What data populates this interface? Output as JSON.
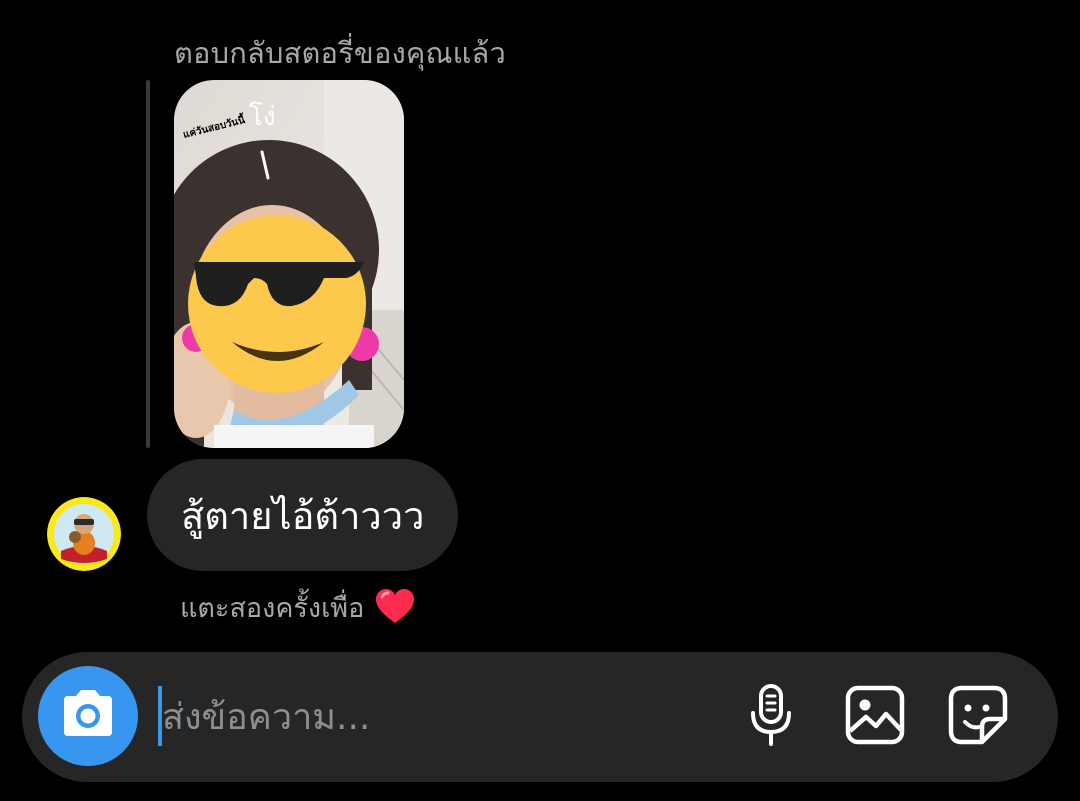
{
  "thread": {
    "reply_context": "ตอบกลับสตอรี่ของคุณแล้ว",
    "story_stickers": {
      "caption": "แค่วันสอบวันนี้",
      "handwriting": "โง่"
    },
    "message": {
      "text": "สู้ตายไอ้ต้าววว"
    },
    "double_tap_hint": "แตะสองครั้งเพื่อ"
  },
  "composer": {
    "placeholder": "ส่งข้อความ...",
    "value": "",
    "icons": [
      "camera-icon",
      "microphone-icon",
      "gallery-icon",
      "sticker-icon"
    ]
  },
  "colors": {
    "background": "#000000",
    "bubble": "#262626",
    "accent": "#3797f0",
    "muted_text": "#a8a8a8",
    "heart": "#ff2b4f"
  }
}
